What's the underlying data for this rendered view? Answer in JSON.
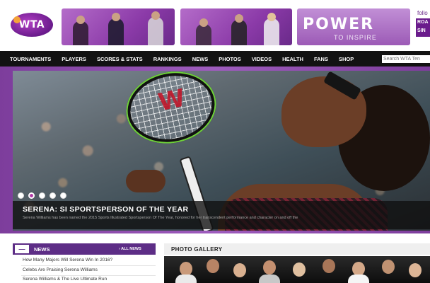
{
  "header": {
    "logo_text": "WTA",
    "banner_power": "POWER",
    "banner_tagline": "TO INSPIRE",
    "follow_text": "follo",
    "road_badge": "ROA SIN"
  },
  "nav": {
    "items": [
      "TOURNAMENTS",
      "PLAYERS",
      "SCORES & STATS",
      "RANKINGS",
      "NEWS",
      "PHOTOS",
      "VIDEOS",
      "HEALTH",
      "FANS",
      "SHOP"
    ],
    "search_placeholder": "Search WTA Ten"
  },
  "hero": {
    "racket_logo": "W",
    "slides_count": 5,
    "active_slide": 2,
    "title": "SERENA: SI SPORTSPERSON OF THE YEAR",
    "description": "Serena Williams has been named the 2015 Sports Illustrated Sportsperson Of The Year, honored for her transcendent performance and character on and off the"
  },
  "news": {
    "toggle": "—",
    "label": "NEWS",
    "all_news": "› ALL NEWS",
    "items": [
      "How Many Majors Will Serena Win In 2016?",
      "Celebs Are Praising Serena Williams",
      "Serena Williams & The Live Ultimate Run"
    ]
  },
  "gallery": {
    "label": "PHOTO GALLERY"
  },
  "colors": {
    "brand_purple": "#5d2d86",
    "frame_purple": "#8b4aab",
    "nav_black": "#121212",
    "active_dot": "#b03aa6"
  }
}
